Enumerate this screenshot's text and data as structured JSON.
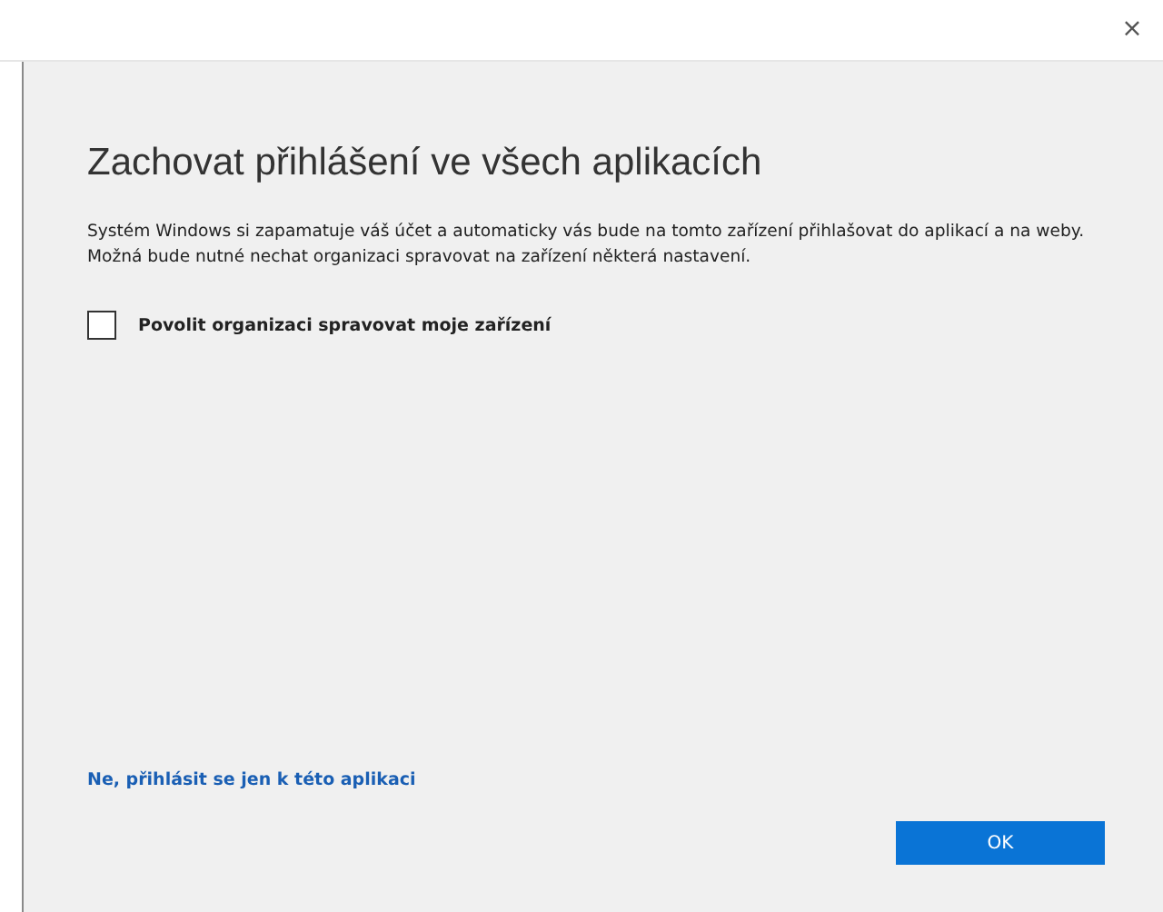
{
  "window": {
    "close": "×"
  },
  "title": "Zachovat přihlášení ve všech aplikacích",
  "description": "Systém Windows si zapamatuje váš účet a automaticky vás bude na tomto zařízení přihlašovat do aplikací a na weby. Možná bude nutné nechat organizaci spravovat na zařízení některá nastavení.",
  "checkbox": {
    "label": "Povolit organizaci spravovat moje zařízení",
    "checked": false
  },
  "link": "Ne, přihlásit se jen k této aplikaci",
  "buttons": [
    "OK"
  ]
}
